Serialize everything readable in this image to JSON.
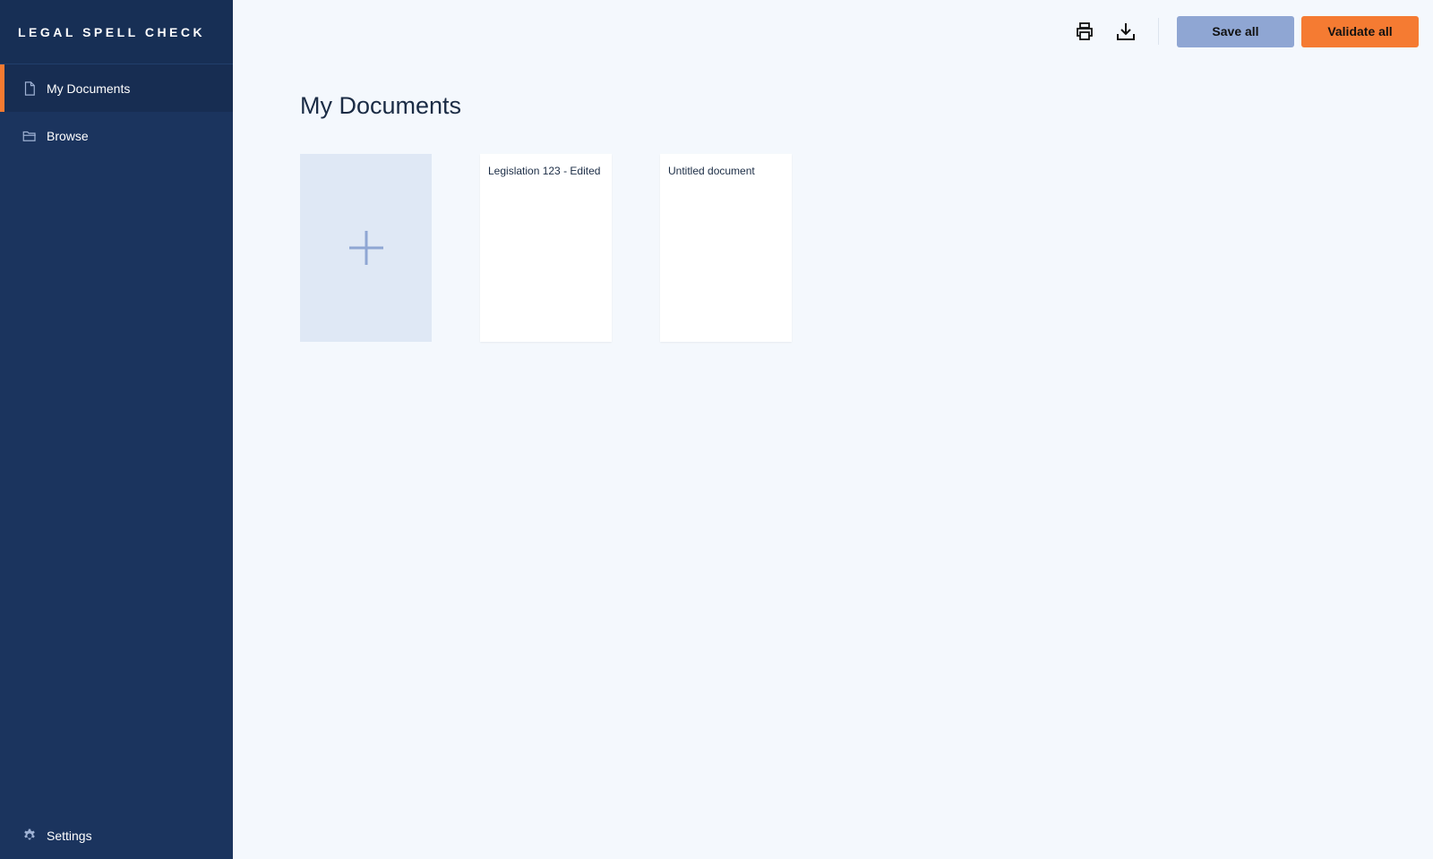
{
  "app": {
    "brand": "LEGAL SPELL CHECK"
  },
  "sidebar": {
    "items": [
      {
        "label": "My Documents",
        "icon": "document-icon",
        "active": true
      },
      {
        "label": "Browse",
        "icon": "folder-icon",
        "active": false
      }
    ],
    "settings_label": "Settings"
  },
  "toolbar": {
    "print_icon": "print-icon",
    "download_icon": "download-icon",
    "save_label": "Save all",
    "validate_label": "Validate all"
  },
  "main": {
    "title": "My Documents",
    "documents": [
      {
        "title": "Legislation 123 - Edited"
      },
      {
        "title": "Untitled document"
      }
    ]
  },
  "colors": {
    "sidebar": "#1b345e",
    "accent": "#f47a31",
    "save_button": "#8fa6d3",
    "background": "#f4f8fd"
  }
}
